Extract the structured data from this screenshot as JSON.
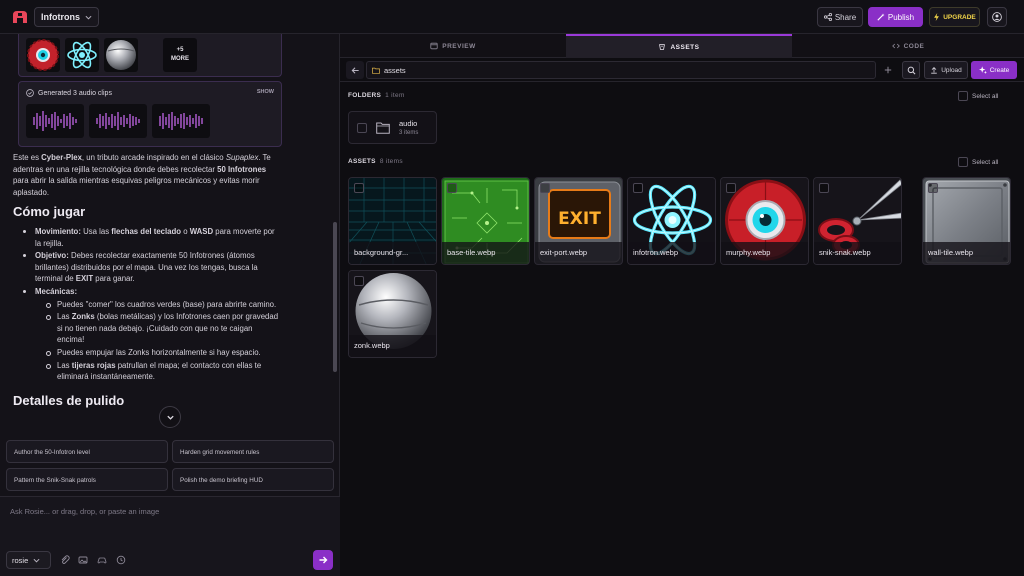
{
  "topbar": {
    "project_name": "Infotrons",
    "share_label": "Share",
    "publish_label": "Publish",
    "upgrade_label": "UPGRADE"
  },
  "chat": {
    "more_count": "+5",
    "more_label": "MORE",
    "audio_card_title": "Generated 3 audio clips",
    "audio_show_label": "SHOW",
    "intro": {
      "p1": "Este es ",
      "b1": "Cyber-Plex",
      "p2": ", un tributo arcade inspirado en el clásico ",
      "i1": "Supaplex",
      "p3": ". Te adentras en una rejilla tecnológica donde debes recolectar ",
      "b2": "50 Infotrones",
      "p4": " para abrir la salida mientras esquivas peligros mecánicos y evitas morir aplastado."
    },
    "how_to_play_heading": "Cómo jugar",
    "bullets": {
      "movement_title": "Movimiento:",
      "movement_a": " Usa las ",
      "movement_b": "flechas del teclado",
      "movement_c": " o ",
      "movement_d": "WASD",
      "movement_e": " para moverte por la rejilla.",
      "objective_title": "Objetivo:",
      "objective_a": " Debes recolectar exactamente 50 Infotrones (átomos brillantes) distribuidos por el mapa. Una vez los tengas, busca la terminal de ",
      "objective_b": "EXIT",
      "objective_c": " para ganar.",
      "mechanics_title": "Mecánicas:",
      "sub1": "Puedes \"comer\" los cuadros verdes (base) para abrirte camino.",
      "sub2_a": "Las ",
      "sub2_b": "Zonks",
      "sub2_c": " (bolas metálicas) y los Infotrones caen por gravedad si no tienen nada debajo. ¡Cuidado con que no te caigan encima!",
      "sub3": "Puedes empujar las Zonks horizontalmente si hay espacio.",
      "sub4_a": "Las ",
      "sub4_b": "tijeras rojas",
      "sub4_c": " patrullan el mapa; el contacto con ellas te eliminará instantáneamente."
    },
    "polish_heading": "Detalles de pulido"
  },
  "suggestions": [
    "Author the 50-Infotron level",
    "Harden grid movement rules",
    "Pattern the Snik-Snak patrols",
    "Polish the demo briefing HUD"
  ],
  "prompt": {
    "placeholder": "Ask Rosie... or drag, drop, or paste an image",
    "model": "rosie"
  },
  "tabs": [
    "PREVIEW",
    "ASSETS",
    "CODE"
  ],
  "active_tab": "ASSETS",
  "assets_panel": {
    "path": "assets",
    "upload_label": "Upload",
    "create_label": "Create",
    "folders_label": "FOLDERS",
    "folders_count": "1 item",
    "select_all_label": "Select all",
    "folders": [
      {
        "name": "audio",
        "count": "3 items"
      }
    ],
    "assets_label": "ASSETS",
    "assets_count": "8 items",
    "assets": [
      "background-gr...",
      "base-tile.webp",
      "exit-port.webp",
      "infotron.webp",
      "murphy.webp",
      "snik-snak.webp",
      "wall-tile.webp",
      "zonk.webp"
    ],
    "exit_sign_text": "EXIT"
  },
  "colors": {
    "accent": "#8a2fc7",
    "upgrade": "#f3d64a",
    "background": "#0e0d11",
    "panel": "#141218"
  }
}
